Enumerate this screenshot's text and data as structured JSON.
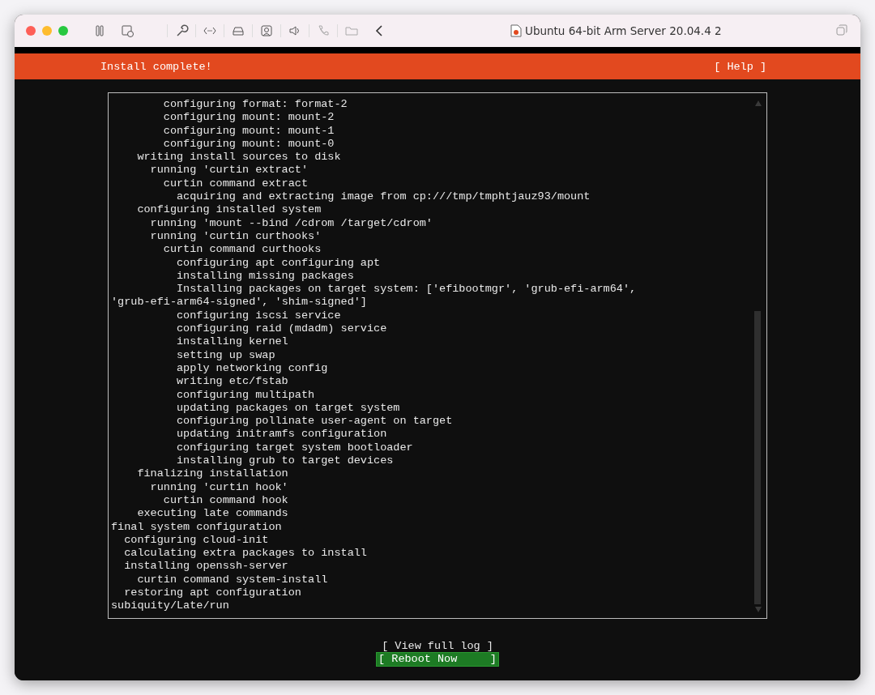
{
  "window": {
    "title": "Ubuntu 64-bit Arm Server 20.04.4 2"
  },
  "header": {
    "title": "Install complete!",
    "help": "[ Help ]"
  },
  "log": [
    {
      "children": [
        {
          "children": [
            {
              "children": [
                {
                  "children": [
                    {
                      "text": "configuring format: format-2"
                    },
                    {
                      "text": "configuring mount: mount-2"
                    },
                    {
                      "text": "configuring mount: mount-1"
                    },
                    {
                      "text": "configuring mount: mount-0"
                    }
                  ]
                }
              ]
            },
            {
              "text": "writing install sources to disk",
              "children": [
                {
                  "text": "running 'curtin extract'",
                  "children": [
                    {
                      "text": "curtin command extract",
                      "children": [
                        {
                          "text": "acquiring and extracting image from cp:///tmp/tmphtjauz93/mount"
                        }
                      ]
                    }
                  ]
                }
              ]
            },
            {
              "text": "configuring installed system",
              "children": [
                {
                  "text": "running 'mount --bind /cdrom /target/cdrom'"
                },
                {
                  "text": "running 'curtin curthooks'",
                  "children": [
                    {
                      "text": "curtin command curthooks",
                      "children": [
                        {
                          "text": "configuring apt configuring apt"
                        },
                        {
                          "text": "installing missing packages"
                        },
                        {
                          "text": "Installing packages on target system: ['efibootmgr', 'grub-efi-arm64', 'grub-efi-arm64-signed', 'shim-signed']"
                        },
                        {
                          "text": "configuring iscsi service"
                        },
                        {
                          "text": "configuring raid (mdadm) service"
                        },
                        {
                          "text": "installing kernel"
                        },
                        {
                          "text": "setting up swap"
                        },
                        {
                          "text": "apply networking config"
                        },
                        {
                          "text": "writing etc/fstab"
                        },
                        {
                          "text": "configuring multipath"
                        },
                        {
                          "text": "updating packages on target system"
                        },
                        {
                          "text": "configuring pollinate user-agent on target"
                        },
                        {
                          "text": "updating initramfs configuration"
                        },
                        {
                          "text": "configuring target system bootloader"
                        },
                        {
                          "text": "installing grub to target devices"
                        }
                      ]
                    }
                  ]
                }
              ]
            },
            {
              "text": "finalizing installation",
              "children": [
                {
                  "text": "running 'curtin hook'",
                  "children": [
                    {
                      "text": "curtin command hook"
                    }
                  ]
                }
              ]
            },
            {
              "text": "executing late commands"
            }
          ]
        }
      ]
    },
    {
      "text": "final system configuration",
      "children": [
        {
          "text": "configuring cloud-init"
        },
        {
          "text": "calculating extra packages to install"
        },
        {
          "text": "installing openssh-server",
          "children": [
            {
              "text": "curtin command system-install"
            }
          ]
        },
        {
          "text": "restoring apt configuration"
        }
      ]
    },
    {
      "text": "subiquity/Late/run"
    }
  ],
  "buttons": [
    {
      "label": "[ View full log ]",
      "selected": false
    },
    {
      "label": "[ Reboot Now     ]",
      "selected": true
    }
  ]
}
